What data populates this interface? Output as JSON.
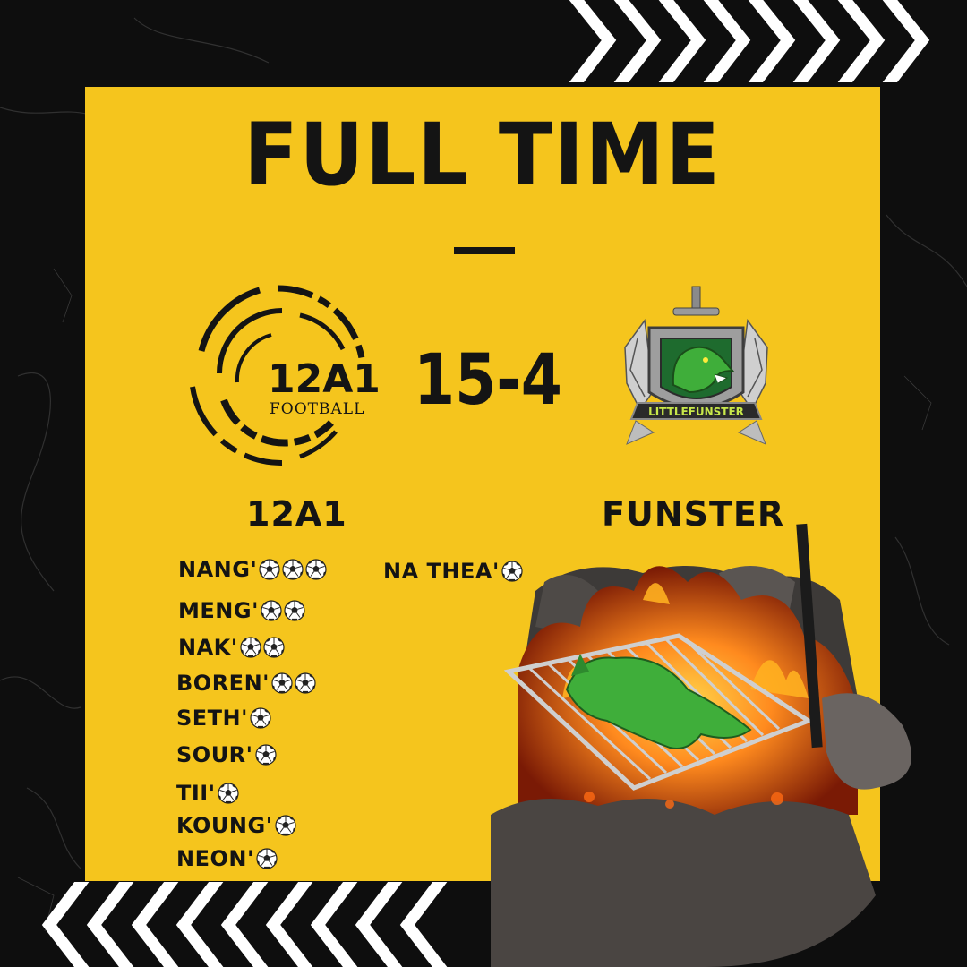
{
  "title": "FULL TIME",
  "score": "15-4",
  "home": {
    "name": "12A1",
    "logo_text": "12A1",
    "logo_subtext": "FOOTBALL",
    "scorers": [
      {
        "name": "NANG'",
        "goals": 3
      },
      {
        "name": "MENG'",
        "goals": 2
      },
      {
        "name": "NAK'",
        "goals": 2
      },
      {
        "name": "BOREN'",
        "goals": 2
      },
      {
        "name": "SETH'",
        "goals": 1
      },
      {
        "name": "SOUR'",
        "goals": 1
      },
      {
        "name": "TII'",
        "goals": 1
      },
      {
        "name": "KOUNG'",
        "goals": 1
      },
      {
        "name": "NEON'",
        "goals": 1
      }
    ]
  },
  "away": {
    "name": "FUNSTER",
    "logo_text": "LITTLEFUNSTER",
    "scorers": [
      {
        "name": "NA THEA'",
        "goals": 1
      }
    ]
  },
  "colors": {
    "panel": "#f5c51d",
    "ink": "#141414",
    "background": "#0d0d0d",
    "dragon": "#3fae3a"
  },
  "icons": [
    "soccer-ball-icon",
    "chevron-stripe-icon",
    "dragon-crest-icon",
    "fire-grill-image"
  ]
}
